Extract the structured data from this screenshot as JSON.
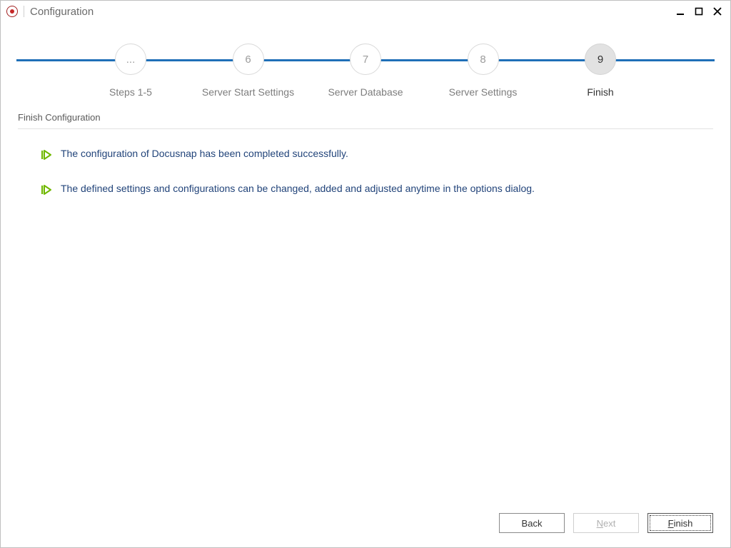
{
  "window": {
    "title": "Configuration"
  },
  "wizard": {
    "steps": [
      {
        "num": "...",
        "label": "Steps 1-5",
        "active": false
      },
      {
        "num": "6",
        "label": "Server Start Settings",
        "active": false
      },
      {
        "num": "7",
        "label": "Server Database",
        "active": false
      },
      {
        "num": "8",
        "label": "Server Settings",
        "active": false
      },
      {
        "num": "9",
        "label": "Finish",
        "active": true
      }
    ]
  },
  "section": {
    "title": "Finish Configuration"
  },
  "messages": {
    "line1": "The configuration of Docusnap has been completed successfully.",
    "line2": "The defined settings and configurations can be changed, added and adjusted anytime in the options dialog."
  },
  "footer": {
    "back": "Back",
    "next_prefix": "N",
    "next_rest": "ext",
    "finish_prefix": "F",
    "finish_rest": "inish"
  },
  "colors": {
    "accent": "#1f6fb8",
    "icon_green": "#70b800",
    "link_text": "#22447a"
  }
}
